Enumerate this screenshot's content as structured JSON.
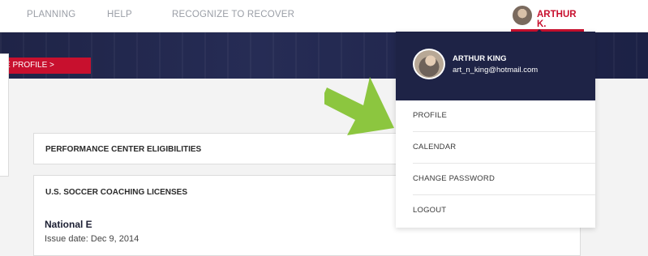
{
  "nav": {
    "items": [
      {
        "label": "PLANNING"
      },
      {
        "label": "HELP"
      },
      {
        "label": "RECOGNIZE TO RECOVER"
      }
    ],
    "user_short_name": "ARTHUR K."
  },
  "banner": {
    "button_label": "E PROFILE  >"
  },
  "cards": {
    "eligibilities_title": "PERFORMANCE CENTER ELIGIBILITIES",
    "licenses_title": "U.S. SOCCER COACHING LICENSES",
    "license_name": "National E",
    "license_issue": "Issue date: Dec 9, 2014"
  },
  "dropdown": {
    "user_name": "ARTHUR KING",
    "user_email": "art_n_king@hotmail.com",
    "items": [
      {
        "label": "PROFILE"
      },
      {
        "label": "CALENDAR"
      },
      {
        "label": "CHANGE PASSWORD"
      },
      {
        "label": "LOGOUT"
      }
    ]
  },
  "colors": {
    "accent": "#c8102e",
    "navy": "#1e2346",
    "arrow": "#8cc63f"
  }
}
